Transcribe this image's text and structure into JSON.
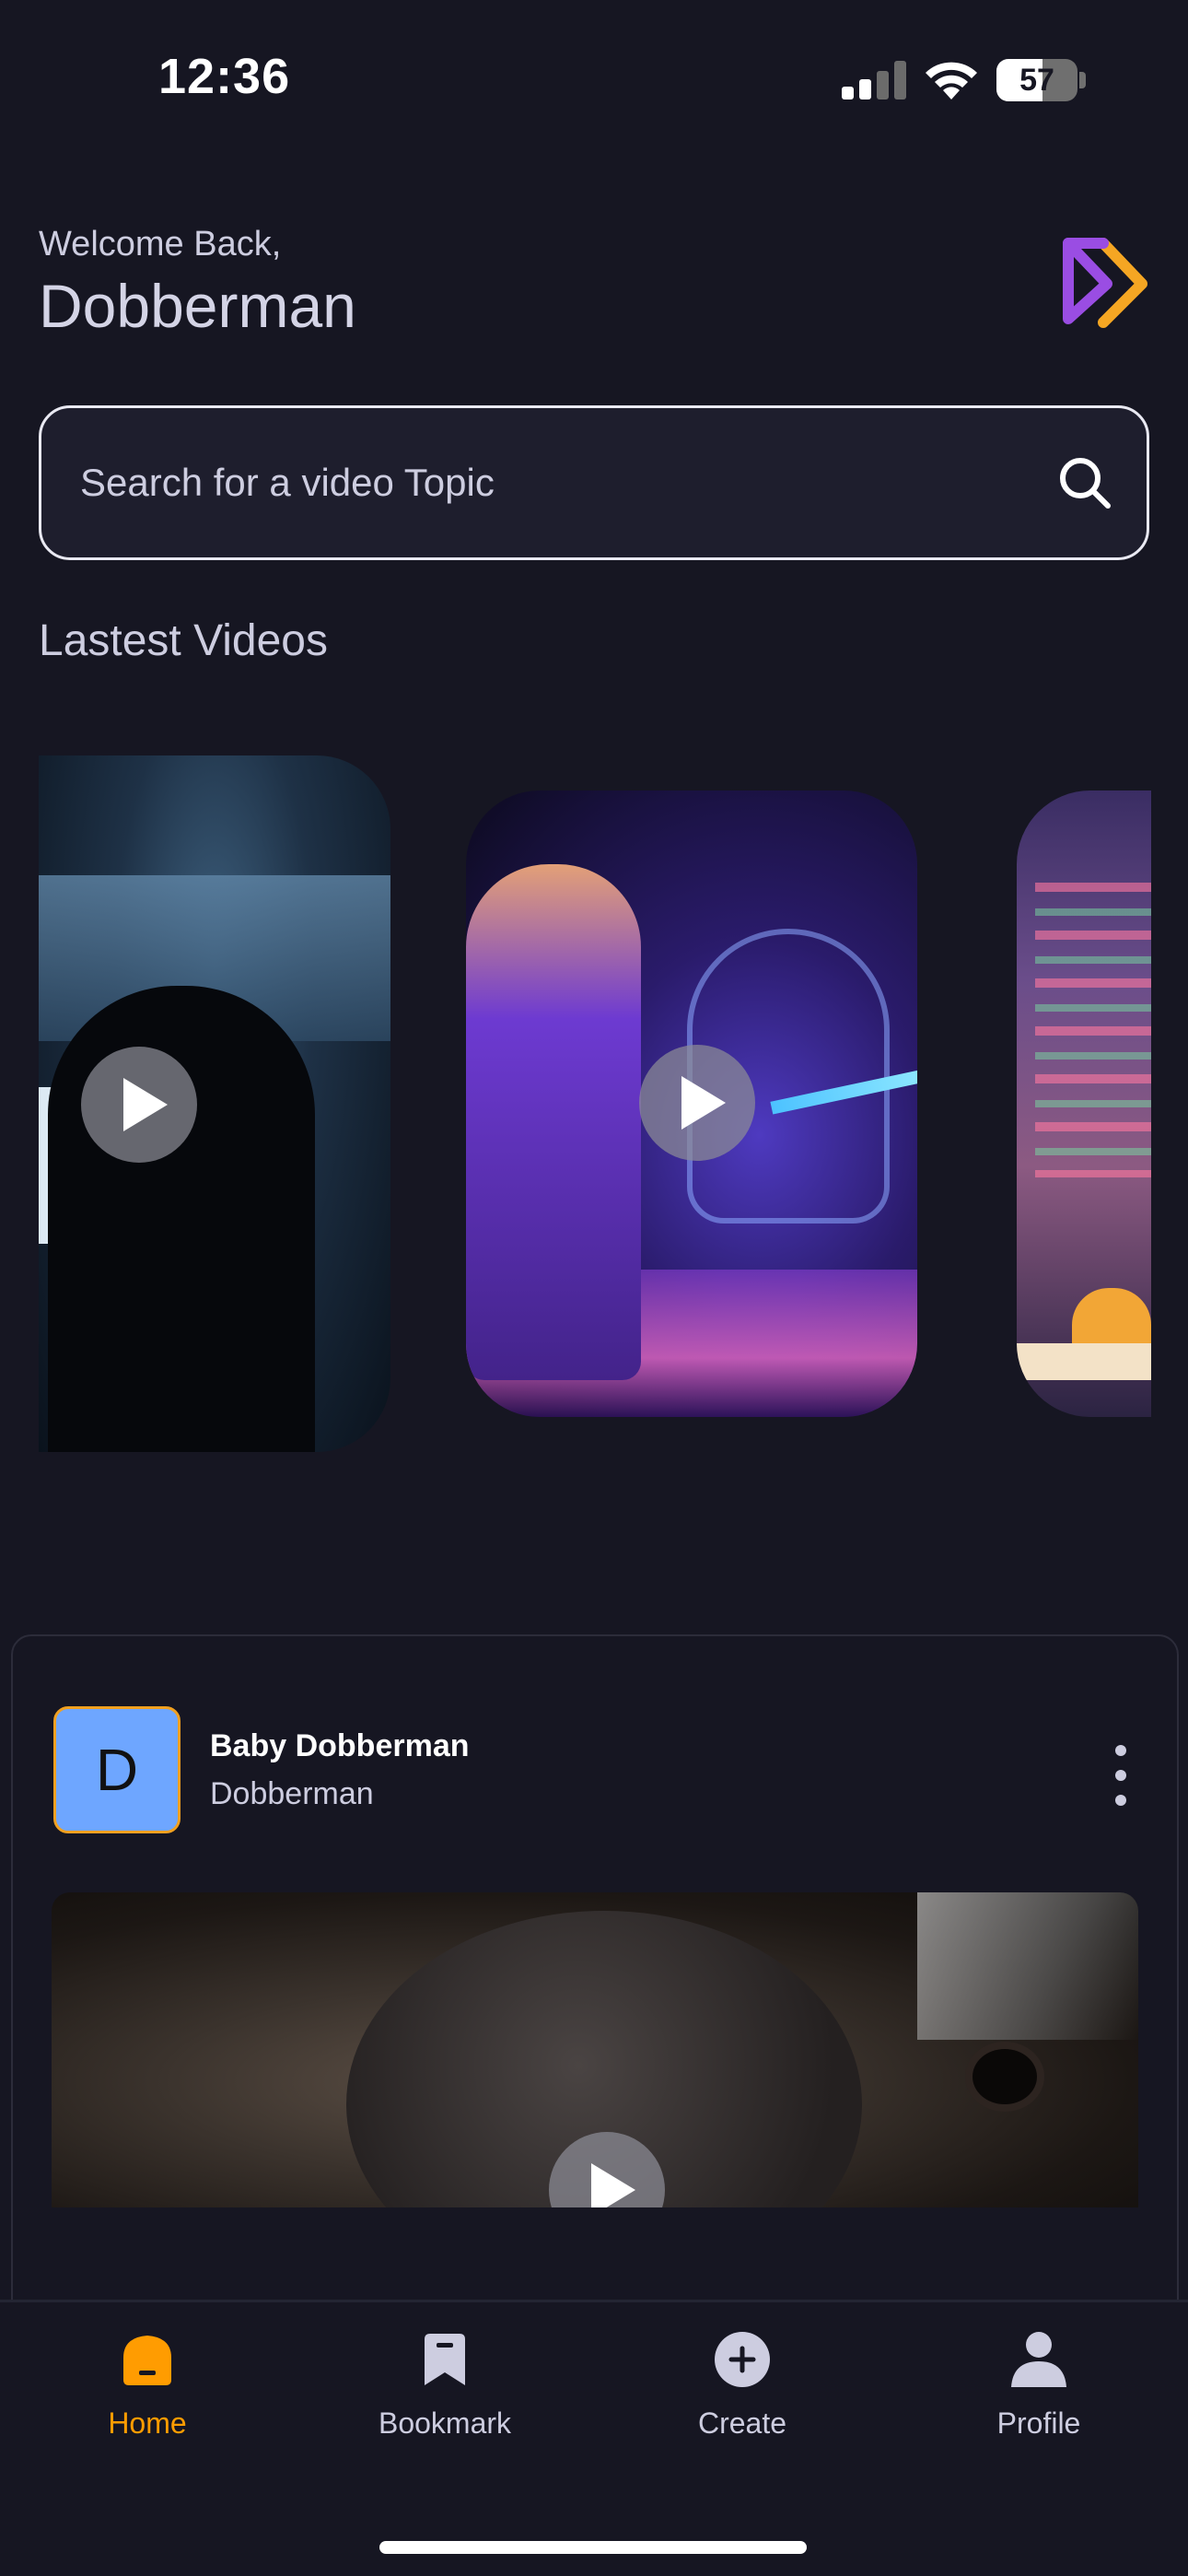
{
  "status_bar": {
    "time": "12:36",
    "battery": "57",
    "icons": [
      "signal-icon",
      "wifi-icon",
      "battery-icon"
    ]
  },
  "header": {
    "welcome": "Welcome Back,",
    "username": "Dobberman",
    "logo_icon": "app-logo-icon"
  },
  "search": {
    "placeholder": "Search for a video Topic",
    "icon": "search-icon"
  },
  "latest": {
    "title": "Lastest Videos",
    "videos": [
      {
        "name": "hooded-hacker-video"
      },
      {
        "name": "vr-robot-video"
      },
      {
        "name": "coding-screen-video"
      }
    ]
  },
  "post": {
    "avatar_letter": "D",
    "title": "Baby Dobberman",
    "author": "Dobberman"
  },
  "tabs": [
    {
      "label": "Home",
      "icon": "home-icon",
      "active": true
    },
    {
      "label": "Bookmark",
      "icon": "bookmark-icon",
      "active": false
    },
    {
      "label": "Create",
      "icon": "plus-circle-icon",
      "active": false
    },
    {
      "label": "Profile",
      "icon": "user-icon",
      "active": false
    }
  ],
  "colors": {
    "background": "#161622",
    "accent": "#ff9c01",
    "logo_purple": "#9a4de3",
    "avatar_blue": "#6ea6ff"
  }
}
